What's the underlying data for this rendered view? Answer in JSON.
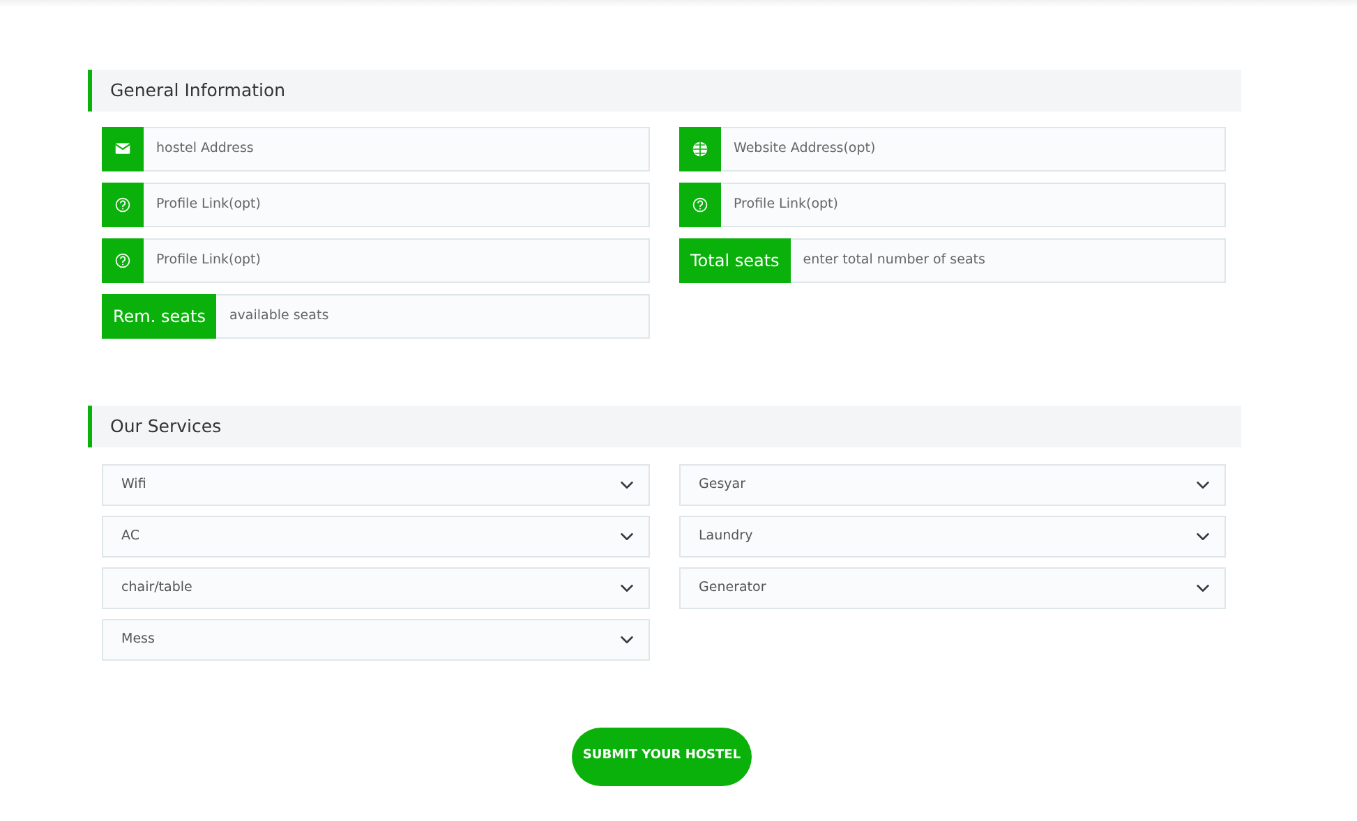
{
  "sections": [
    {
      "title": "General Information",
      "kind": "inputs",
      "fields": [
        {
          "kind": "email",
          "placeholder": "hostel Address"
        },
        {
          "kind": "website",
          "placeholder": "Website Address(opt)"
        },
        {
          "kind": "help",
          "placeholder": "Profile Link(opt)"
        },
        {
          "kind": "help",
          "placeholder": "Profile Link(opt)"
        },
        {
          "kind": "help",
          "placeholder": "Profile Link(opt)"
        },
        {
          "kind": "label",
          "label": "Total seats",
          "placeholder": "enter total number of seats"
        },
        {
          "kind": "label",
          "label": "Rem. seats",
          "placeholder": "available seats"
        }
      ]
    },
    {
      "title": "Our Services",
      "kind": "selects",
      "fields": [
        {
          "value": "Wifi"
        },
        {
          "value": "Gesyar"
        },
        {
          "value": "AC"
        },
        {
          "value": "Laundry"
        },
        {
          "value": "chair/table"
        },
        {
          "value": "Generator"
        },
        {
          "value": "Mess"
        }
      ]
    }
  ],
  "submit_button": "SUBMIT YOUR HOSTEL"
}
